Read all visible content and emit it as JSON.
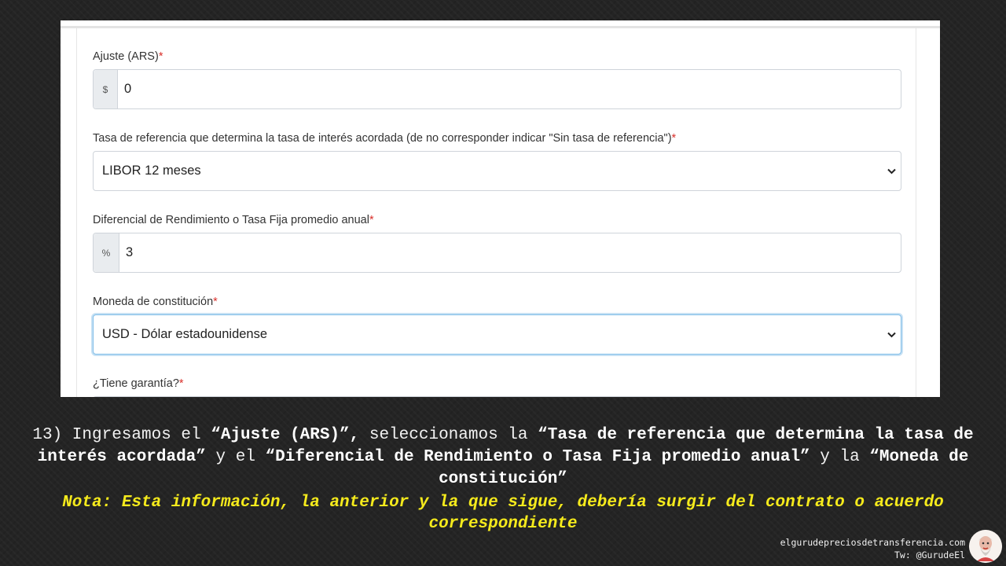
{
  "form": {
    "ajuste": {
      "label": "Ajuste (ARS)",
      "required": "*",
      "addon": "$",
      "value": "0"
    },
    "tasa_referencia": {
      "label": "Tasa de referencia que determina la tasa de interés acordada (de no corresponder indicar \"Sin tasa de referencia\")",
      "required": "*",
      "selected": "LIBOR 12 meses"
    },
    "diferencial": {
      "label": "Diferencial de Rendimiento o Tasa Fija promedio anual",
      "required": "*",
      "addon": "%",
      "value": "3"
    },
    "moneda": {
      "label": "Moneda de constitución",
      "required": "*",
      "selected": "USD - Dólar estadounidense"
    },
    "garantia": {
      "label": "¿Tiene garantía?",
      "required": "*"
    }
  },
  "caption": {
    "step": "13) Ingresamos el ",
    "b1": "“Ajuste (ARS)”,",
    "t2": " seleccionamos la ",
    "b2": "“Tasa de referencia que determina la tasa de interés acordada”",
    "t3": " y el ",
    "b3": "“Diferencial de Rendimiento o Tasa Fija promedio anual”",
    "t4": " y la ",
    "b4": "“Moneda de constitución”",
    "note": "Nota: Esta información, la anterior y la que sigue, debería surgir del contrato o acuerdo correspondiente"
  },
  "footer": {
    "site": "elgurudepreciosdetransferencia.com",
    "twitter": "Tw: @GurudeEl"
  },
  "colors": {
    "background": "#242424",
    "required": "#d9302b",
    "note": "#f5ea1c",
    "focus": "#7fbde8"
  }
}
